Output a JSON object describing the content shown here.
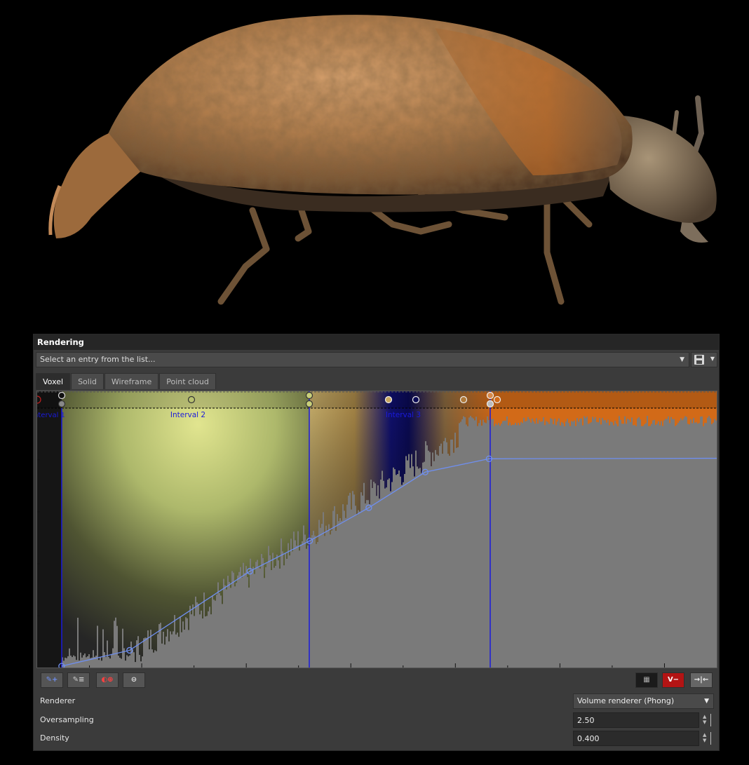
{
  "viewport": {
    "subject": "beetle-3d-volume-render"
  },
  "panel": {
    "title": "Rendering",
    "preset_placeholder": "Select an entry from the list...",
    "tabs": [
      {
        "label": "Voxel",
        "active": true
      },
      {
        "label": "Solid",
        "active": false
      },
      {
        "label": "Wireframe",
        "active": false
      },
      {
        "label": "Point cloud",
        "active": false
      }
    ],
    "intervals": [
      {
        "label": "Interval 1"
      },
      {
        "label": "Interval 2"
      },
      {
        "label": "Interval 3"
      }
    ],
    "opacity_curve": [
      [
        0.036,
        0.0
      ],
      [
        0.136,
        0.063
      ],
      [
        0.313,
        0.378
      ],
      [
        0.401,
        0.499
      ],
      [
        0.488,
        0.631
      ],
      [
        0.571,
        0.773
      ],
      [
        0.665,
        0.826
      ],
      [
        1.0,
        0.828
      ]
    ],
    "toolbar": {
      "left": [
        "add-point-icon",
        "edit-point-icon",
        "add-interval-icon",
        "remove-interval-icon"
      ],
      "right": [
        "grid-toggle-icon",
        "v-minus-icon",
        "fit-icon"
      ],
      "v_minus_label": "V−"
    },
    "properties": {
      "renderer_label": "Renderer",
      "renderer_value": "Volume renderer (Phong)",
      "oversampling_label": "Oversampling",
      "oversampling_value": "2.50",
      "density_label": "Density",
      "density_value": "0.400"
    },
    "colors": {
      "accent_blue": "#1a1adc",
      "curve": "#6f8ff0",
      "interval2_color": "#c8cf7a",
      "interval3_color": "#d26a18",
      "histogram": "#7a7a7a",
      "danger": "#b31414"
    }
  }
}
